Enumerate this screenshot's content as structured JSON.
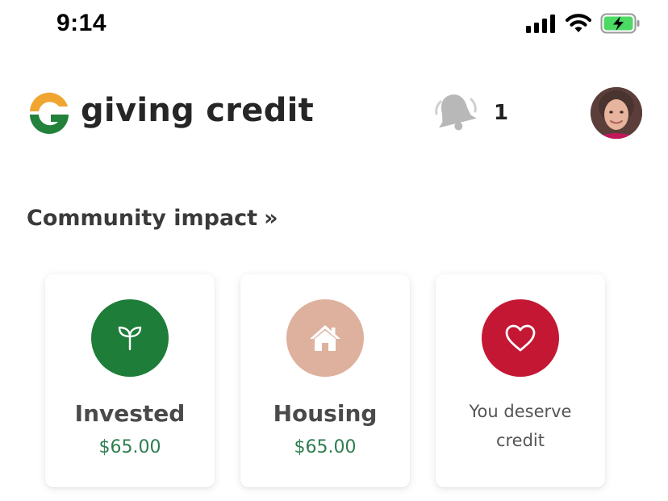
{
  "status_bar": {
    "time": "9:14",
    "icons": [
      "cellular-signal-icon",
      "wifi-icon",
      "battery-charging-icon"
    ]
  },
  "header": {
    "logo_text": "giving credit",
    "logo_icon": "giving-credit-logo-icon",
    "notification_icon": "bell-icon",
    "notification_count": "1",
    "avatar": "user-avatar"
  },
  "section": {
    "title": "Community impact",
    "arrow_glyph": "»"
  },
  "cards": [
    {
      "icon": "sprout-icon",
      "color": "#1e7d38",
      "title": "Invested",
      "amount": "$65.00"
    },
    {
      "icon": "house-icon",
      "color": "#ddb19d",
      "title": "Housing",
      "amount": "$65.00"
    },
    {
      "icon": "heart-icon",
      "color": "#c41734",
      "text_line1": "You deserve",
      "text_line2": "credit"
    }
  ],
  "colors": {
    "amount_green": "#2e7d4f",
    "logo_orange": "#f0a531",
    "logo_green": "#22813a"
  }
}
